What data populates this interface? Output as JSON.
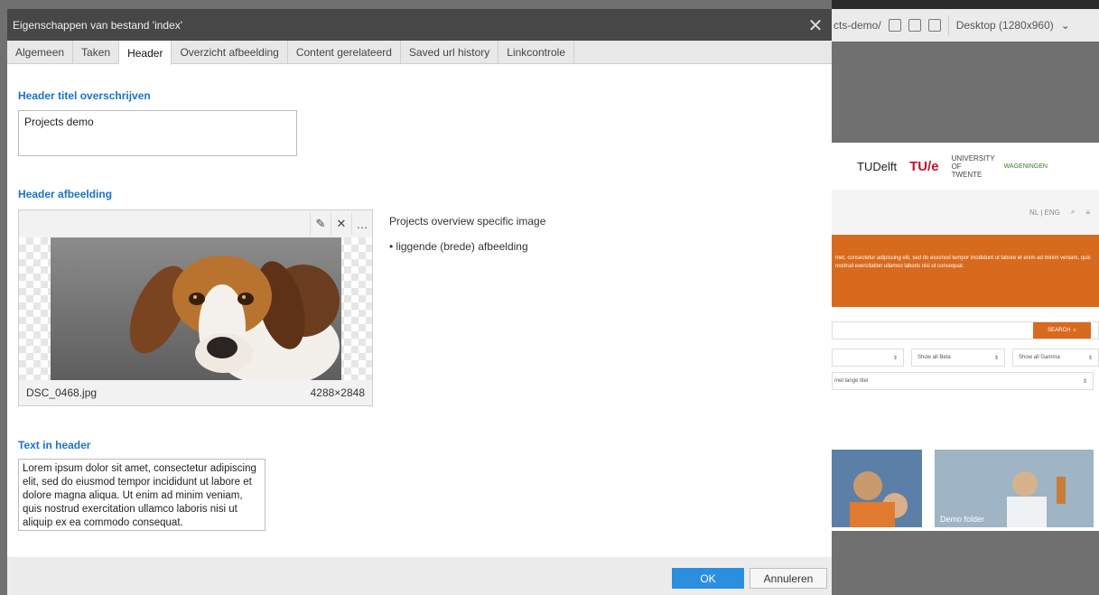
{
  "background": {
    "topbar": {
      "path": "cts-demo/",
      "viewport": "Desktop (1280x960)"
    },
    "logos": {
      "tudelft": "TUDelft",
      "tue": "TU/e",
      "twente": "UNIVERSITY OF TWENTE",
      "wur": "WAGENINGEN"
    },
    "nav": {
      "lang": "NL | ENG"
    },
    "hero_text": "met, consectetur adipiscing elit, sed do eiusmod tempor incididunt ut labore et enim ad minim veniam, quis nostrud exercitation ullamco laboris nisi ut consequat.",
    "search_label": "SEARCH",
    "filters": [
      "",
      "Show all Beta",
      "Show all Gamma"
    ],
    "select_label": "met lange titel",
    "tiles": [
      "",
      "Demo folder"
    ]
  },
  "dialog": {
    "title": "Eigenschappen van bestand 'index'",
    "tabs": [
      "Algemeen",
      "Taken",
      "Header",
      "Overzicht afbeelding",
      "Content gerelateerd",
      "Saved url history",
      "Linkcontrole"
    ],
    "active_tab": "Header",
    "header_title": {
      "label": "Header titel overschrijven",
      "value": "Projects demo"
    },
    "header_image": {
      "label": "Header afbeelding",
      "filename": "DSC_0468.jpg",
      "dimensions": "4288×2848",
      "description": "Projects overview specific image",
      "bullet": "• liggende (brede) afbeelding"
    },
    "text_in_header": {
      "label": "Text in header",
      "value": "Lorem ipsum dolor sit amet, consectetur adipiscing elit, sed do eiusmod tempor incididunt ut labore et dolore magna aliqua. Ut enim ad minim veniam, quis nostrud exercitation ullamco laboris nisi ut aliquip ex ea commodo consequat."
    },
    "buttons": {
      "ok": "OK",
      "cancel": "Annuleren"
    }
  },
  "colors": {
    "accent": "#2b8fe0",
    "label_blue": "#1a73c7",
    "titlebar": "#474747",
    "hero_orange": "#d86a1e"
  }
}
